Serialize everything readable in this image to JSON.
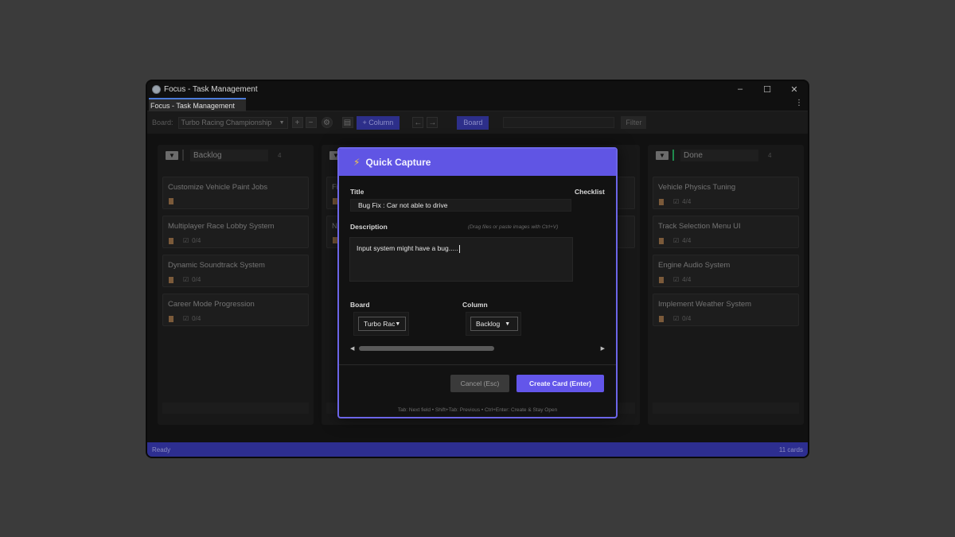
{
  "window": {
    "title": "Focus - Task Management",
    "controls": {
      "minimize": "–",
      "maximize": "☐",
      "close": "✕"
    }
  },
  "tab": {
    "label": "Focus - Task Management",
    "menu": "⋮"
  },
  "toolbar": {
    "board_label": "Board:",
    "board_value": "Turbo Racing Championship",
    "add": "+",
    "remove": "−",
    "add_column": "+ Column",
    "undo": "←",
    "redo": "→",
    "view_board": "Board",
    "filter": "Filter"
  },
  "columns": [
    {
      "title": "Backlog",
      "count": "4",
      "accent": "#333333",
      "cards": [
        {
          "title": "Customize Vehicle Paint Jobs",
          "checklist": ""
        },
        {
          "title": "Multiplayer Race Lobby System",
          "checklist": "0/4"
        },
        {
          "title": "Dynamic Soundtrack System",
          "checklist": "0/4"
        },
        {
          "title": "Career Mode Progression",
          "checklist": "0/4"
        }
      ]
    },
    {
      "title": "",
      "count": "",
      "accent": "#333333",
      "cards": [
        {
          "title": "Fi",
          "checklist": ""
        },
        {
          "title": "N",
          "checklist": ""
        }
      ]
    },
    {
      "title": "Done",
      "count": "4",
      "accent": "#1f8a4d",
      "cards": [
        {
          "title": "Vehicle Physics Tuning",
          "checklist": "4/4"
        },
        {
          "title": "Track Selection Menu UI",
          "checklist": "4/4"
        },
        {
          "title": "Engine Audio System",
          "checklist": "4/4"
        },
        {
          "title": "Implement Weather System",
          "checklist": "0/4"
        }
      ]
    }
  ],
  "status": {
    "left": "Ready",
    "right": "11 cards"
  },
  "dialog": {
    "title": "Quick Capture",
    "title_label": "Title",
    "title_value": "Bug Fix : Car not able to drive",
    "checklist_label": "Checklist",
    "description_label": "Description",
    "description_hint": "(Drag files or paste images with Ctrl+V)",
    "description_value": "Input system might have a bug.....",
    "board_label": "Board",
    "board_value": "Turbo Rac",
    "column_label": "Column",
    "column_value": "Backlog",
    "cancel": "Cancel (Esc)",
    "create": "Create Card (Enter)",
    "footer": "Tab: Next field • Shift+Tab: Previous • Ctrl+Enter: Create & Stay Open"
  }
}
